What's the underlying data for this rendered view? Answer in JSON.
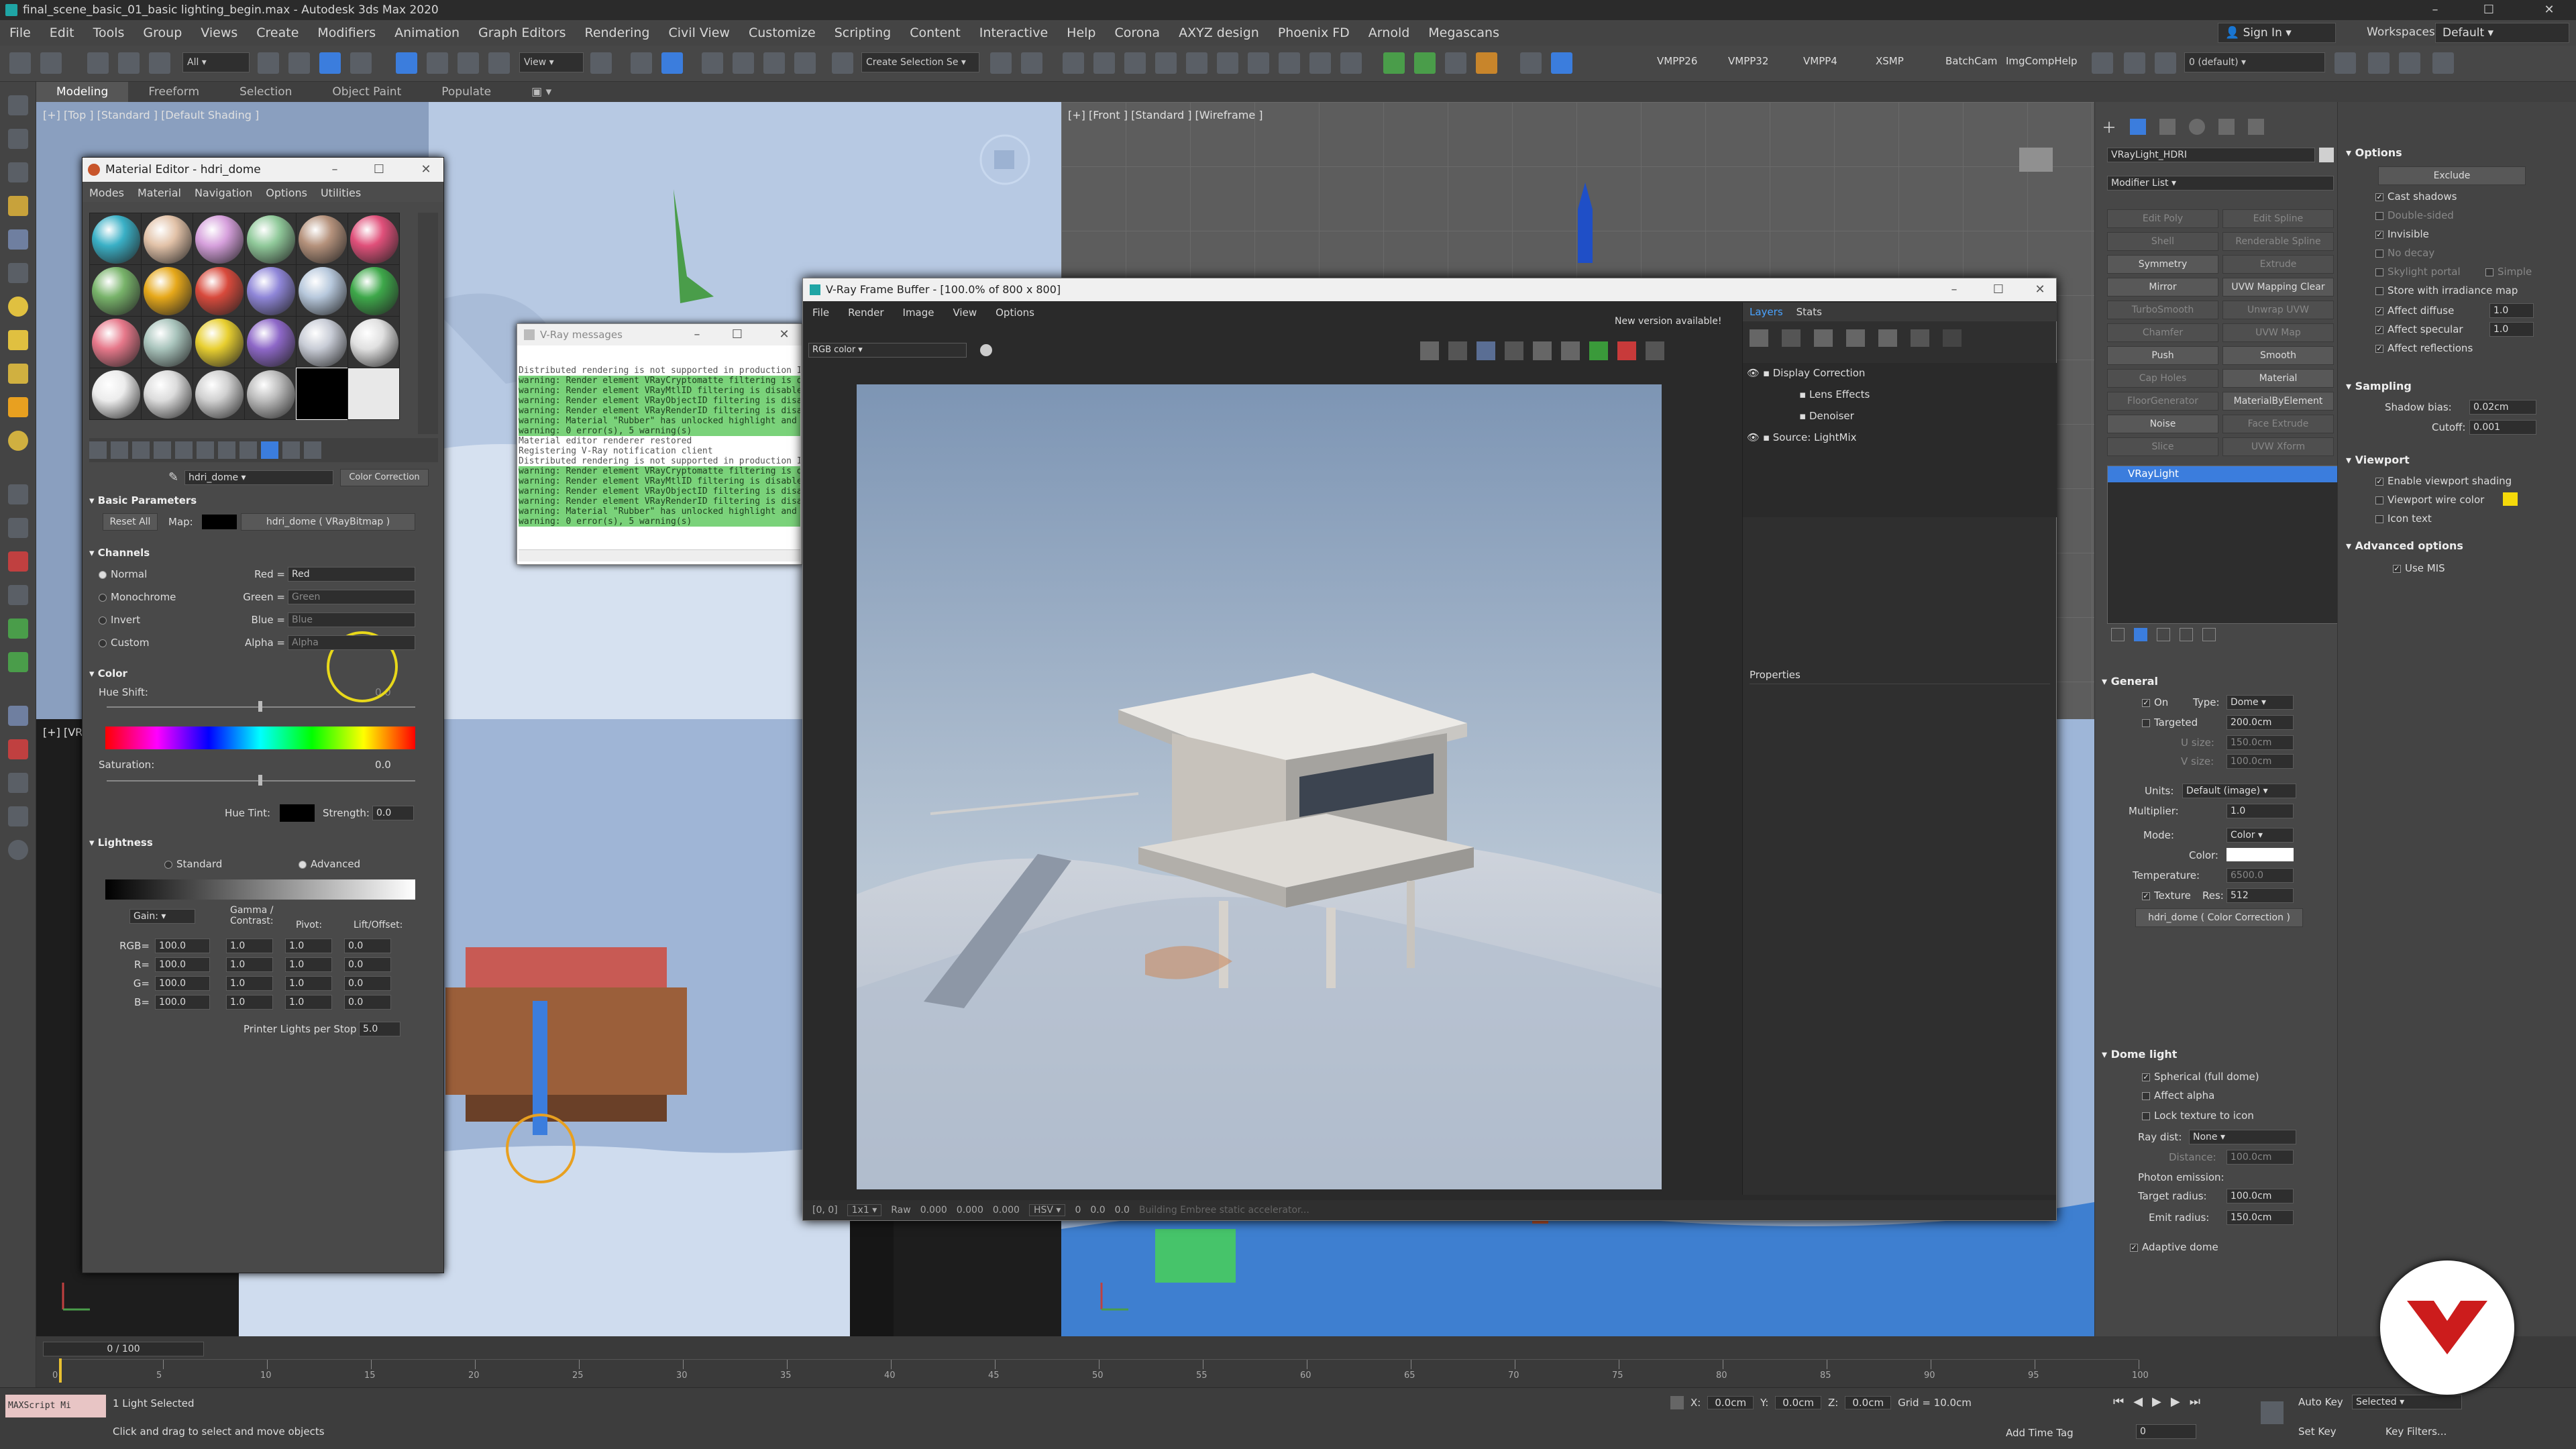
{
  "window": {
    "title": "final_scene_basic_01_basic lighting_begin.max - Autodesk 3ds Max 2020",
    "minimize": "–",
    "maximize": "☐",
    "close": "✕"
  },
  "menu": {
    "items": [
      "File",
      "Edit",
      "Tools",
      "Group",
      "Views",
      "Create",
      "Modifiers",
      "Animation",
      "Graph Editors",
      "Rendering",
      "Civil View",
      "Customize",
      "Scripting",
      "Content",
      "Interactive",
      "Help",
      "Corona",
      "AXYZ design",
      "Phoenix FD",
      "Arnold",
      "Megascans"
    ],
    "signin": "Sign In",
    "workspaces_label": "Workspaces:",
    "workspaces_value": "Default"
  },
  "toolbar": {
    "filter": "All",
    "refcoord": "View",
    "selset": "Create Selection Se",
    "plugins": [
      "VMPP26",
      "VMPP32",
      "VMPP4",
      "XSMP",
      "BatchCam",
      "ImgCompHelp"
    ],
    "layer": "0 (default)"
  },
  "ribbon": {
    "tabs": [
      "Modeling",
      "Freeform",
      "Selection",
      "Object Paint",
      "Populate"
    ]
  },
  "viewports": {
    "top": "[+] [Top ] [Standard ] [Default Shading ]",
    "front": "[+] [Front ] [Standard ] [Wireframe ]",
    "left": "[+] [VR"
  },
  "mated": {
    "title": "Material Editor - hdri_dome",
    "menus": [
      "Modes",
      "Material",
      "Navigation",
      "Options",
      "Utilities"
    ],
    "mat_name": "hdri_dome",
    "mat_type": "Color Correction",
    "basic": {
      "header": "Basic Parameters",
      "reset": "Reset All",
      "map_label": "Map:",
      "map_value": "hdri_dome  ( VRayBitmap )"
    },
    "channels": {
      "header": "Channels",
      "rows": [
        {
          "label": "Normal",
          "ch": "Red =",
          "val": "Red"
        },
        {
          "label": "Monochrome",
          "ch": "Green =",
          "val": "Green"
        },
        {
          "label": "Invert",
          "ch": "Blue =",
          "val": "Blue"
        },
        {
          "label": "Custom",
          "ch": "Alpha =",
          "val": "Alpha"
        }
      ]
    },
    "color": {
      "header": "Color",
      "hue_label": "Hue Shift:",
      "hue_val": "0.0",
      "sat_label": "Saturation:",
      "sat_val": "0.0",
      "tint_label": "Hue Tint:",
      "strength_label": "Strength:",
      "strength_val": "0.0"
    },
    "lightness": {
      "header": "Lightness",
      "standard": "Standard",
      "advanced": "Advanced",
      "gain": "Gain:",
      "col_gamma": "Gamma / Contrast:",
      "col_pivot": "Pivot:",
      "col_lift": "Lift/Offset:",
      "rows": [
        {
          "l": "RGB=",
          "a": "100.0",
          "b": "1.0",
          "c": "1.0",
          "d": "0.0"
        },
        {
          "l": "R=",
          "a": "100.0",
          "b": "1.0",
          "c": "1.0",
          "d": "0.0"
        },
        {
          "l": "G=",
          "a": "100.0",
          "b": "1.0",
          "c": "1.0",
          "d": "0.0"
        },
        {
          "l": "B=",
          "a": "100.0",
          "b": "1.0",
          "c": "1.0",
          "d": "0.0"
        }
      ],
      "printer_label": "Printer Lights per Stop",
      "printer_val": "5.0"
    }
  },
  "vmsg": {
    "title": "V-Ray messages",
    "lines": [
      {
        "t": "Distributed rendering is not supported in production IPR mod",
        "w": false
      },
      {
        "t": "warning: Render element VRayCryptomatte filtering is disable",
        "w": true
      },
      {
        "t": "warning: Render element VRayMtlID filtering is disabled. Thi",
        "w": true
      },
      {
        "t": "warning: Render element VRayObjectID filtering is disabled.",
        "w": true
      },
      {
        "t": "warning: Render element VRayRenderID filtering is disabled.",
        "w": true
      },
      {
        "t": "warning: Material \"Rubber\" has unlocked highlight and reflec",
        "w": true
      },
      {
        "t": "warning: 0 error(s), 5 warning(s)",
        "w": true
      },
      {
        "t": "Material editor renderer restored",
        "w": false
      },
      {
        "t": "Registering V-Ray notification client",
        "w": false
      },
      {
        "t": "Distributed rendering is not supported in production IPR mod",
        "w": false
      },
      {
        "t": "warning: Render element VRayCryptomatte filtering is disable",
        "w": true
      },
      {
        "t": "warning: Render element VRayMtlID filtering is disabled. Thi",
        "w": true
      },
      {
        "t": "warning: Render element VRayObjectID filtering is disabled.",
        "w": true
      },
      {
        "t": "warning: Render element VRayRenderID filtering is disabled.",
        "w": true
      },
      {
        "t": "warning: Material \"Rubber\" has unlocked highlight and reflec",
        "w": true
      },
      {
        "t": "warning: 0 error(s), 5 warning(s)",
        "w": true
      }
    ]
  },
  "vfb": {
    "title": "V-Ray Frame Buffer - [100.0% of 800 x 800]",
    "menus": [
      "File",
      "Render",
      "Image",
      "View",
      "Options"
    ],
    "new_version": "New version available!",
    "channel": "RGB color",
    "tabs": [
      "Layers",
      "Stats"
    ],
    "layers": [
      "Display Correction",
      "Lens Effects",
      "Denoiser",
      "Source: LightMix"
    ],
    "properties": "Properties",
    "status": {
      "coords": "[0, 0]",
      "zoom": "1x1",
      "raw": "Raw",
      "r": "0.000",
      "g": "0.000",
      "b": "0.000",
      "mode": "HSV",
      "h": "0",
      "s": "0.0",
      "v": "0.0",
      "msg": "Building Embree static accelerator..."
    }
  },
  "cmd": {
    "obj_name": "VRayLight_HDRI",
    "modlist": "Modifier List",
    "mods": [
      {
        "a": "Edit Poly",
        "b": "Edit Spline",
        "ea": false,
        "eb": false
      },
      {
        "a": "Shell",
        "b": "Renderable Spline",
        "ea": false,
        "eb": false
      },
      {
        "a": "Symmetry",
        "b": "Extrude",
        "ea": true,
        "eb": false
      },
      {
        "a": "Mirror",
        "b": "UVW Mapping Clear",
        "ea": true,
        "eb": true
      },
      {
        "a": "TurboSmooth",
        "b": "Unwrap UVW",
        "ea": false,
        "eb": false
      },
      {
        "a": "Chamfer",
        "b": "UVW Map",
        "ea": false,
        "eb": false
      },
      {
        "a": "Push",
        "b": "Smooth",
        "ea": true,
        "eb": true
      },
      {
        "a": "Cap Holes",
        "b": "Material",
        "ea": false,
        "eb": true
      },
      {
        "a": "FloorGenerator",
        "b": "MaterialByElement",
        "ea": false,
        "eb": true
      },
      {
        "a": "Noise",
        "b": "Face Extrude",
        "ea": true,
        "eb": false
      },
      {
        "a": "Slice",
        "b": "UVW Xform",
        "ea": false,
        "eb": false
      }
    ],
    "stack_item": "VRayLight",
    "general": {
      "header": "General",
      "on": "On",
      "type_label": "Type:",
      "type_val": "Dome",
      "targeted": "Targeted",
      "targeted_val": "200.0cm",
      "usize": "U size:",
      "usize_val": "150.0cm",
      "vsize": "V size:",
      "vsize_val": "100.0cm",
      "units_label": "Units:",
      "units_val": "Default (image)",
      "mult_label": "Multiplier:",
      "mult_val": "1.0",
      "mode_label": "Mode:",
      "mode_val": "Color",
      "color_label": "Color:",
      "temp_label": "Temperature:",
      "temp_val": "6500.0",
      "texture": "Texture",
      "res_label": "Res:",
      "res_val": "512",
      "tex_map": "hdri_dome  ( Color Correction )"
    },
    "dome": {
      "header": "Dome light",
      "spherical": "Spherical (full dome)",
      "affect_alpha": "Affect alpha",
      "lock": "Lock texture to icon",
      "raydist_label": "Ray dist:",
      "raydist_val": "None",
      "distance_label": "Distance:",
      "distance_val": "100.0cm",
      "photon": "Photon emission:",
      "target_label": "Target radius:",
      "target_val": "100.0cm",
      "emit_label": "Emit radius:",
      "emit_val": "150.0cm",
      "adaptive": "Adaptive dome"
    }
  },
  "rol": {
    "options": {
      "header": "Options",
      "exclude": "Exclude",
      "items": [
        {
          "l": "Cast shadows",
          "c": true,
          "d": false
        },
        {
          "l": "Double-sided",
          "c": false,
          "d": true
        },
        {
          "l": "Invisible",
          "c": true,
          "d": false
        },
        {
          "l": "No decay",
          "c": false,
          "d": true
        },
        {
          "l": "Skylight portal",
          "c": false,
          "d": true
        },
        {
          "l": "Store with irradiance map",
          "c": false,
          "d": false
        }
      ],
      "simple": "Simple",
      "affect_diffuse": "Affect diffuse",
      "affect_diffuse_val": "1.0",
      "affect_specular": "Affect specular",
      "affect_specular_val": "1.0",
      "affect_reflections": "Affect reflections"
    },
    "sampling": {
      "header": "Sampling",
      "bias_label": "Shadow bias:",
      "bias_val": "0.02cm",
      "cutoff_label": "Cutoff:",
      "cutoff_val": "0.001"
    },
    "viewport": {
      "header": "Viewport",
      "shading": "Enable viewport shading",
      "wire": "Viewport wire color",
      "icon": "Icon text"
    },
    "advanced": {
      "header": "Advanced options",
      "mis": "Use MIS"
    }
  },
  "timeline": {
    "frame": "0 / 100",
    "ticks": [
      "0",
      "5",
      "10",
      "15",
      "20",
      "25",
      "30",
      "35",
      "40",
      "45",
      "50",
      "55",
      "60",
      "65",
      "70",
      "75",
      "80",
      "85",
      "90",
      "95",
      "100"
    ]
  },
  "status": {
    "script": "MAXScript Mi",
    "selected": "1 Light Selected",
    "prompt": "Click and drag to select and move objects",
    "x_label": "X:",
    "x_val": "0.0cm",
    "y_label": "Y:",
    "y_val": "0.0cm",
    "z_label": "Z:",
    "z_val": "0.0cm",
    "grid": "Grid = 10.0cm",
    "addtag": "Add Time Tag",
    "autokey": "Auto Key",
    "setkey": "Set Key",
    "selected_dd": "Selected",
    "keyfilters": "Key Filters...",
    "frame_val": "0"
  },
  "colors": {
    "accent": "#3b7ddd",
    "wire_color": "#f5d90a",
    "brand": "#cc1c1c"
  }
}
